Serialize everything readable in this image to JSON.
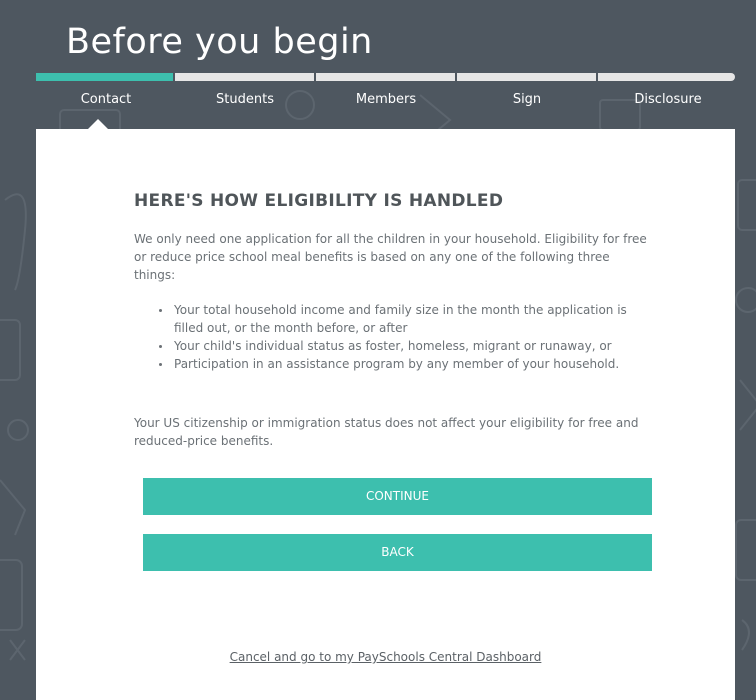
{
  "page": {
    "title": "Before you begin"
  },
  "steps": [
    {
      "label": "Contact"
    },
    {
      "label": "Students"
    },
    {
      "label": "Members"
    },
    {
      "label": "Sign"
    },
    {
      "label": "Disclosure"
    }
  ],
  "progress": {
    "active_step": 1,
    "total_steps": 5
  },
  "card": {
    "heading": "HERE'S HOW ELIGIBILITY IS HANDLED",
    "intro": "We only need one application for all the children in your household. Eligibility for free or reduce price school meal benefits is based on any one of the following three things:",
    "bullets": [
      "Your total household income and family size in the month the application is filled out, or the month before, or after",
      "Your child's individual status as foster, homeless, migrant or runaway, or",
      "Participation in an assistance program by any member of your household."
    ],
    "note": "Your US citizenship or immigration status does not affect your eligibility for free and reduced-price benefits.",
    "continue_label": "CONTINUE",
    "back_label": "BACK",
    "cancel_link": "Cancel and go to my PaySchools Central Dashboard"
  },
  "colors": {
    "accent": "#3dbfae",
    "background": "#4e5760",
    "inactive_step": "#e6e6e6",
    "heading_text": "#4f5559",
    "body_text": "#6b7176"
  }
}
